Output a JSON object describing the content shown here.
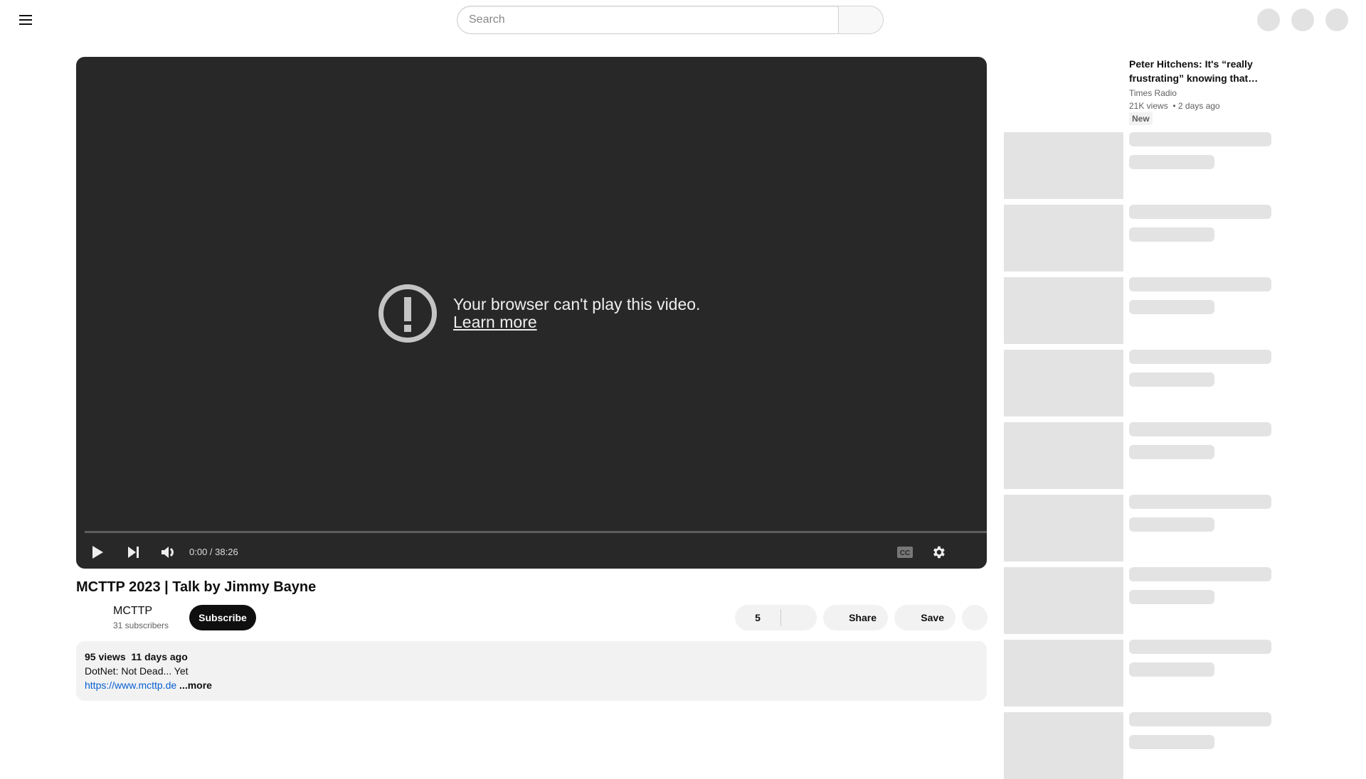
{
  "masthead": {
    "search_placeholder": "Search",
    "icons": [
      "menu-icon",
      "search-icon",
      "create-icon",
      "notifications-icon",
      "account-avatar"
    ]
  },
  "player": {
    "error_message": "Your browser can't play this video.",
    "learn_more": "Learn more",
    "time": "0:00 / 38:26",
    "progress": 0,
    "controls": [
      "play",
      "next",
      "volume",
      "captions",
      "settings"
    ]
  },
  "video": {
    "title": "MCTTP 2023 | Talk by Jimmy Bayne",
    "channel_name": "MCTTP",
    "subscribers": "31 subscribers",
    "subscribe_label": "Subscribe",
    "like_count": "5",
    "share_label": "Share",
    "save_label": "Save"
  },
  "description": {
    "meta": "95 views  11 days ago",
    "line1": "DotNet: Not Dead... Yet",
    "link": "https://www.mcttp.de",
    "more_label": " ...more"
  },
  "recommendations": {
    "first": {
      "title": "Peter Hitchens: It's “really frustrating” knowing that…",
      "channel": "Times Radio",
      "meta": "21K views  • 2 days ago",
      "badge": "New"
    },
    "skeleton_count": 9
  },
  "colors": {
    "player_bg": "#282828",
    "skeleton": "#e3e3e3",
    "link": "#065fd4",
    "subscribe_bg": "#0f0f0f",
    "pill_bg": "#f2f2f2"
  }
}
